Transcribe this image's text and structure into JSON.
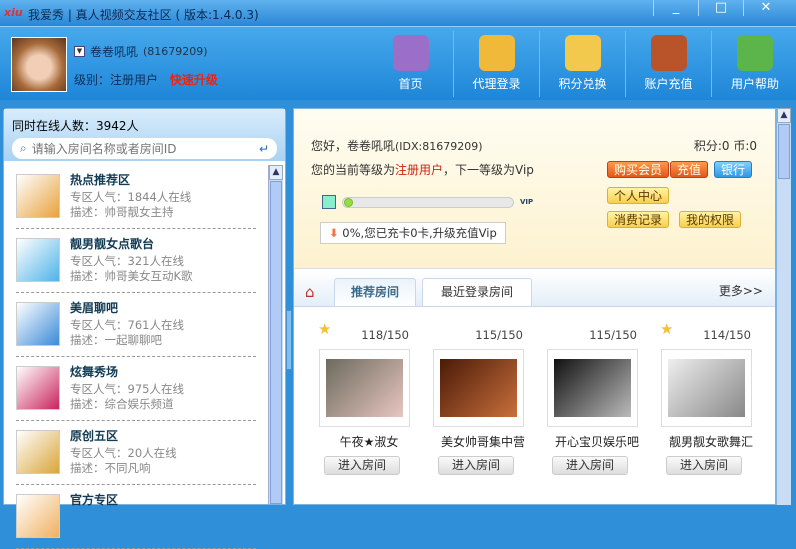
{
  "window": {
    "logo": "xiu",
    "title": "我爱秀 | 真人视频交友社区 ( 版本:1.4.0.3)",
    "min": "_",
    "max": "□",
    "close": "✕"
  },
  "user": {
    "name": "卷卷吼吼",
    "id": "(81679209)",
    "level_label": "级别：注册用户",
    "upgrade": "快速升级"
  },
  "nav": [
    {
      "label": "首页",
      "color": "#9b6fc7"
    },
    {
      "label": "代理登录",
      "color": "#f0b93a"
    },
    {
      "label": "积分兑换",
      "color": "#f2c94c"
    },
    {
      "label": "账户充值",
      "color": "#b9532a"
    },
    {
      "label": "用户帮助",
      "color": "#5bb54a"
    }
  ],
  "left": {
    "online": "同时在线人数：3942人",
    "search_placeholder": "请输入房间名称或者房间ID",
    "zones": [
      {
        "name": "热点推荐区",
        "pop": "专区人气：1844人在线",
        "desc": "描述：帅哥靓女主持",
        "color": "#e8a23c"
      },
      {
        "name": "靓男靓女点歌台",
        "pop": "专区人气：321人在线",
        "desc": "描述：帅哥美女互动K歌",
        "color": "#4fb3e8"
      },
      {
        "name": "美眉聊吧",
        "pop": "专区人气：761人在线",
        "desc": "描述：一起聊聊吧",
        "color": "#3a8ad8"
      },
      {
        "name": "炫舞秀场",
        "pop": "专区人气：975人在线",
        "desc": "描述：综合娱乐频道",
        "color": "#c8245a"
      },
      {
        "name": "原创五区",
        "pop": "专区人气：20人在线",
        "desc": "描述：不同凡响",
        "color": "#d9a53a"
      },
      {
        "name": "官方专区",
        "pop": "",
        "desc": "",
        "color": "#f0b060"
      }
    ]
  },
  "info": {
    "hello": "您好，卷卷吼吼",
    "idx": "(IDX:81679209)",
    "points": "积分:0 币:0",
    "level_prefix": "您的当前等级为",
    "level": "注册用户",
    "level_suffix": "，下一等级为Vip",
    "progress_percent": 0,
    "vip": "VIP",
    "tip": "0%,您已充卡0卡,升级充值Vip",
    "buttons": {
      "buy": "购买会员",
      "recharge": "充值",
      "bank": "银行",
      "center": "个人中心",
      "records": "消费记录",
      "rights": "我的权限"
    }
  },
  "tabs": {
    "recommended": "推荐房间",
    "recent": "最近登录房间",
    "more": "更多>>"
  },
  "rooms": [
    {
      "name": "午夜★淑女",
      "count": "118/150",
      "star": true,
      "enter": "进入房间",
      "colors": [
        "#6c6a5d",
        "#e8c6c0"
      ]
    },
    {
      "name": "美女帅哥集中营",
      "count": "115/150",
      "star": false,
      "enter": "进入房间",
      "colors": [
        "#4a1a08",
        "#c9703a"
      ]
    },
    {
      "name": "开心宝贝娱乐吧",
      "count": "115/150",
      "star": false,
      "enter": "进入房间",
      "colors": [
        "#111",
        "#bbb"
      ]
    },
    {
      "name": "靓男靓女歌舞汇",
      "count": "114/150",
      "star": true,
      "enter": "进入房间",
      "colors": [
        "#eee",
        "#888"
      ]
    }
  ]
}
